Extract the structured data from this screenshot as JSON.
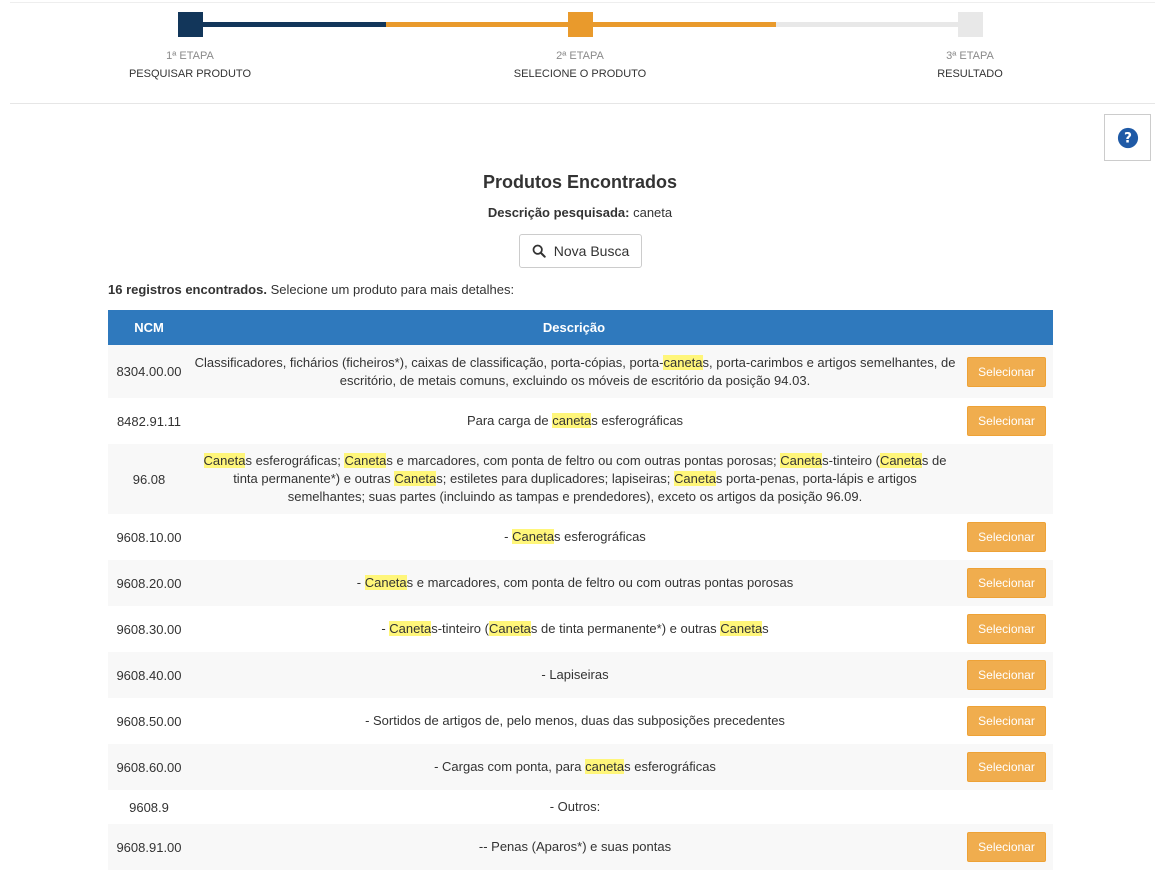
{
  "stepper": {
    "steps": [
      {
        "number": "1ª ETAPA",
        "name": "PESQUISAR PRODUTO"
      },
      {
        "number": "2ª ETAPA",
        "name": "SELECIONE O PRODUTO"
      },
      {
        "number": "3ª ETAPA",
        "name": "RESULTADO"
      }
    ],
    "colors": {
      "done": "#12365a",
      "active": "#e99a2c",
      "pending": "#e8e8e8"
    }
  },
  "help": {
    "icon": "question-circle-icon",
    "color": "#1f5aa6"
  },
  "header": {
    "title": "Produtos Encontrados",
    "searched_label": "Descrição pesquisada:",
    "searched_value": "caneta",
    "new_search_label": "Nova Busca"
  },
  "results": {
    "count_label": "16 registros encontrados.",
    "hint": "Selecione um produto para mais detalhes:"
  },
  "table": {
    "columns": {
      "ncm": "NCM",
      "description": "Descrição"
    },
    "select_label": "Selecionar",
    "header_color": "#2f79bd",
    "button_color": "#f0ad4e",
    "highlight_term": "caneta",
    "rows": [
      {
        "ncm": "8304.00.00",
        "description": "Classificadores, fichários (ficheiros*), caixas de classificação, porta-cópias, porta-canetas, porta-carimbos e artigos semelhantes, de escritório, de metais comuns, excluindo os móveis de escritório da posição 94.03.",
        "selectable": true
      },
      {
        "ncm": "8482.91.11",
        "description": "Para carga de canetas esferográficas",
        "selectable": true
      },
      {
        "ncm": "96.08",
        "description": "Canetas esferográficas; Canetas e marcadores, com ponta de feltro ou com outras pontas porosas; Canetas-tinteiro (Canetas de tinta permanente*) e outras Canetas; estiletes para duplicadores; lapiseiras; Canetas porta-penas, porta-lápis e artigos semelhantes; suas partes (incluindo as tampas e prendedores), exceto os artigos da posição 96.09.",
        "selectable": false
      },
      {
        "ncm": "9608.10.00",
        "description": "- Canetas esferográficas",
        "selectable": true
      },
      {
        "ncm": "9608.20.00",
        "description": "- Canetas e marcadores, com ponta de feltro ou com outras pontas porosas",
        "selectable": true
      },
      {
        "ncm": "9608.30.00",
        "description": "- Canetas-tinteiro (Canetas de tinta permanente*) e outras Canetas",
        "selectable": true
      },
      {
        "ncm": "9608.40.00",
        "description": "- Lapiseiras",
        "selectable": true
      },
      {
        "ncm": "9608.50.00",
        "description": "- Sortidos de artigos de, pelo menos, duas das subposições precedentes",
        "selectable": true
      },
      {
        "ncm": "9608.60.00",
        "description": "- Cargas com ponta, para canetas esferográficas",
        "selectable": true
      },
      {
        "ncm": "9608.9",
        "description": "- Outros:",
        "selectable": false
      },
      {
        "ncm": "9608.91.00",
        "description": "-- Penas (Aparos*) e suas pontas",
        "selectable": true
      }
    ]
  }
}
